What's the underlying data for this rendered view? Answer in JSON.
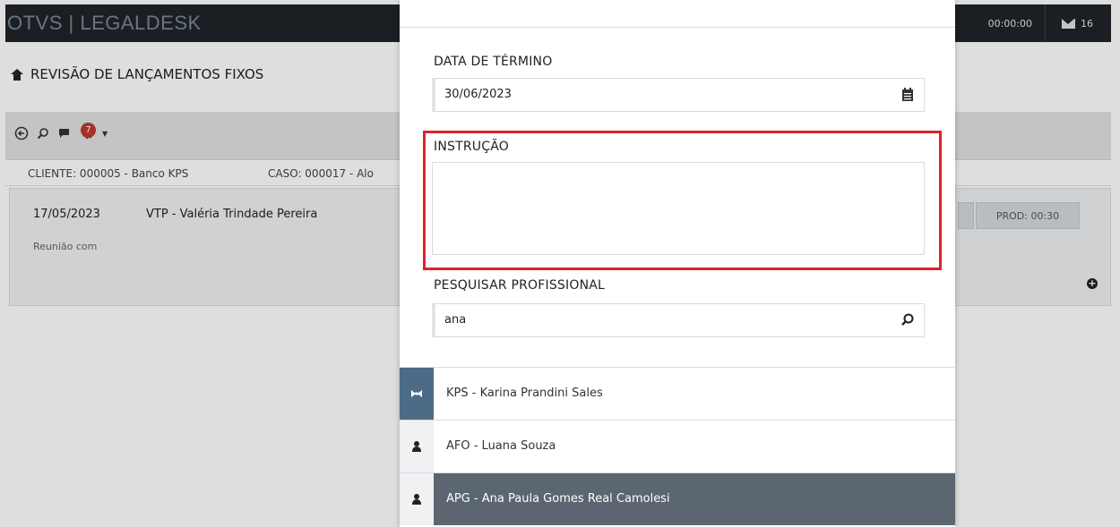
{
  "app": {
    "brand": "OTVS | LEGALDESK",
    "timer": "00:00:00",
    "mail_count": "16",
    "page_title": "REVISÃO DE LANÇAMENTOS FIXOS",
    "toolbar": {
      "notification_count": "7"
    },
    "filter": {
      "cliente": "CLIENTE: 000005 - Banco KPS",
      "caso": "CASO: 000017 - Alo"
    },
    "entry": {
      "date": "17/05/2023",
      "professional": "VTP - Valéria Trindade Pereira",
      "description": "Reunião com",
      "prod": "PROD: 00:30"
    }
  },
  "panel": {
    "end_date": {
      "label": "DATA DE TÉRMINO",
      "value": "30/06/2023"
    },
    "instruction": {
      "label": "INSTRUÇÃO",
      "value": ""
    },
    "search": {
      "label": "PESQUISAR PROFISSIONAL",
      "value": "ana"
    },
    "results": [
      {
        "label": "KPS - Karina Prandini Sales",
        "icon": "bowtie-icon",
        "state": "first"
      },
      {
        "label": "AFO - Luana Souza",
        "icon": "user-icon",
        "state": "normal"
      },
      {
        "label": "APG - Ana Paula Gomes Real Camolesi",
        "icon": "user-icon",
        "state": "active"
      }
    ]
  },
  "colors": {
    "highlight": "#e0232b",
    "topbar": "#1f2429",
    "active_row": "#5c6670",
    "first_gutter": "#4c6b86"
  }
}
